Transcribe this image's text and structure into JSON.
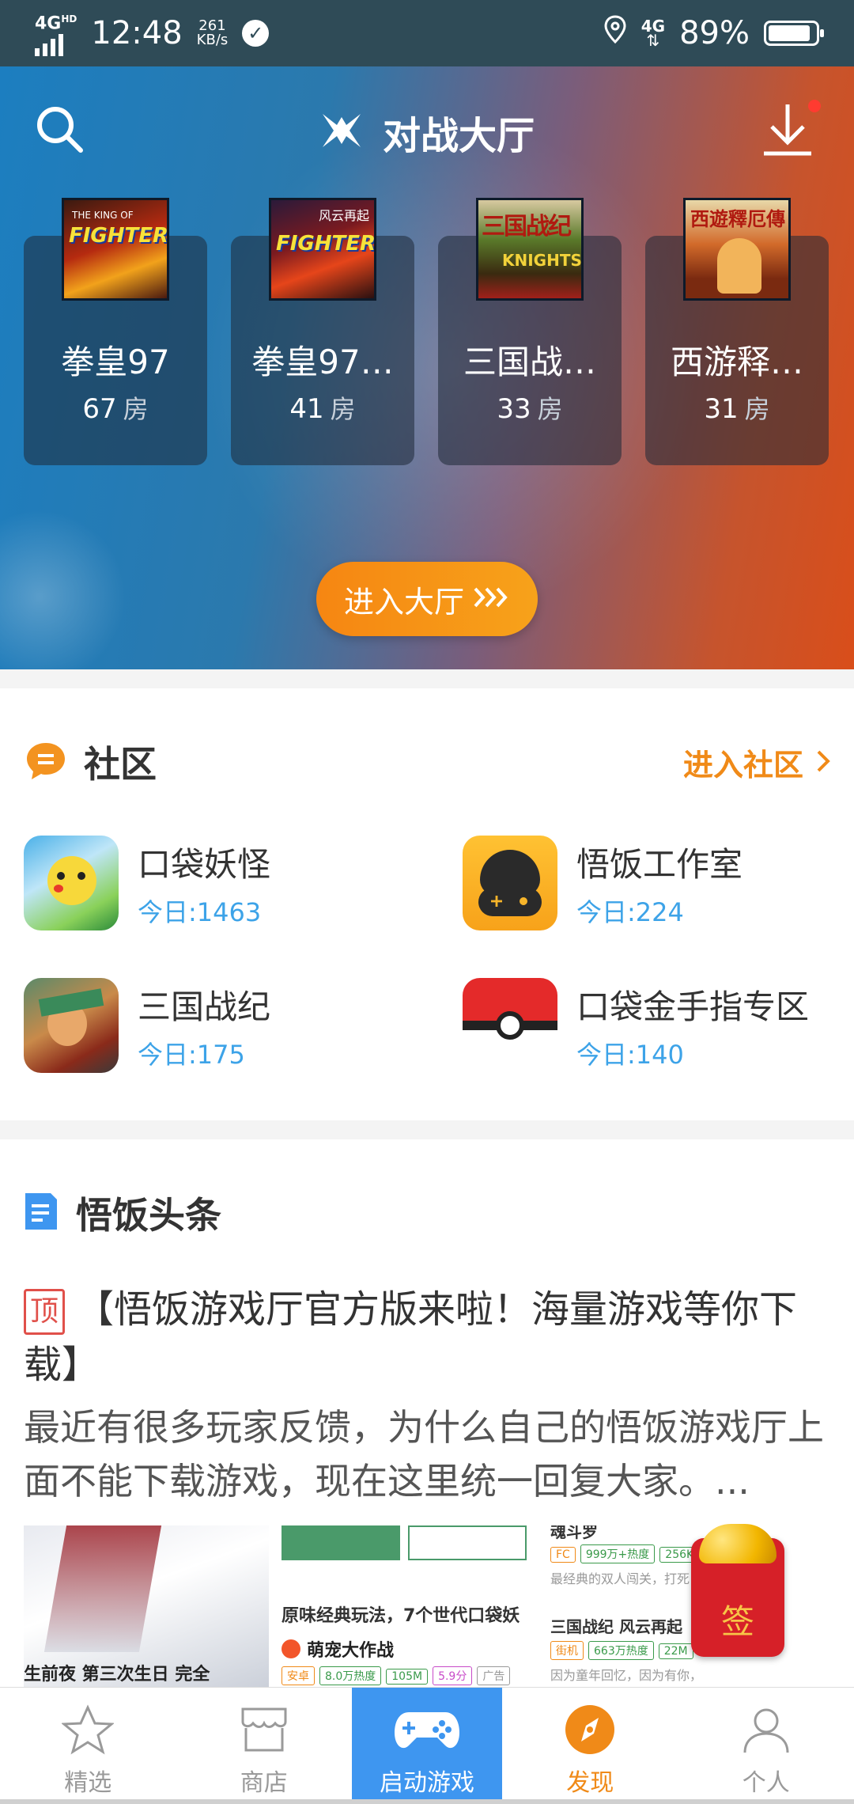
{
  "status_bar": {
    "network": "4G",
    "network_sup": "HD",
    "time": "12:48",
    "speed_value": "261",
    "speed_unit": "KB/s",
    "right_network": "4G",
    "battery": "89%",
    "battery_level": 0.89
  },
  "hero": {
    "title": "对战大厅",
    "enter_button": "进入大厅",
    "games": [
      {
        "name": "拳皇97",
        "rooms": "67",
        "unit": "房"
      },
      {
        "name": "拳皇97…",
        "rooms": "41",
        "unit": "房"
      },
      {
        "name": "三国战…",
        "rooms": "33",
        "unit": "房"
      },
      {
        "name": "西游释…",
        "rooms": "31",
        "unit": "房"
      }
    ]
  },
  "community": {
    "title": "社区",
    "more": "进入社区",
    "items": [
      {
        "name": "口袋妖怪",
        "today": "今日:1463"
      },
      {
        "name": "悟饭工作室",
        "today": "今日:224"
      },
      {
        "name": "三国战纪",
        "today": "今日:175"
      },
      {
        "name": "口袋金手指专区",
        "today": "今日:140"
      }
    ]
  },
  "news": {
    "title": "悟饭头条",
    "top_tag": "顶",
    "headline": "【悟饭游戏厅官方版来啦！海量游戏等你下载】",
    "summary": "最近有很多玩家反馈，为什么自己的悟饭游戏厅上面不能下载游戏，现在这里统一回复大家。...",
    "thumb1_caption": "生前夜 第三次生日 完全",
    "thumb2_caption": "原味经典玩法，7个世代口袋妖",
    "thumb2_ad_title": "萌宠大作战",
    "thumb2_tags": [
      "安卓",
      "8.0万热度",
      "105M",
      "5.9分",
      "广告"
    ],
    "thumb3_title_top": "魂斗罗",
    "thumb3_tags_top": [
      "FC",
      "999万+热度",
      "256K"
    ],
    "thumb3_desc_top": "最经典的双人闯关，打死",
    "thumb3_title": "三国战纪 风云再起",
    "thumb3_tags": [
      "街机",
      "663万热度",
      "22M"
    ],
    "thumb3_desc": "因为童年回忆，因为有你，所以，相聚",
    "sign_label": "签"
  },
  "nav": {
    "featured": "精选",
    "store": "商店",
    "launch": "启动游戏",
    "discover": "发现",
    "me": "个人"
  },
  "colors": {
    "accent_orange": "#f08a18",
    "accent_blue": "#3e96f0",
    "status_bar": "#2f4b57"
  }
}
